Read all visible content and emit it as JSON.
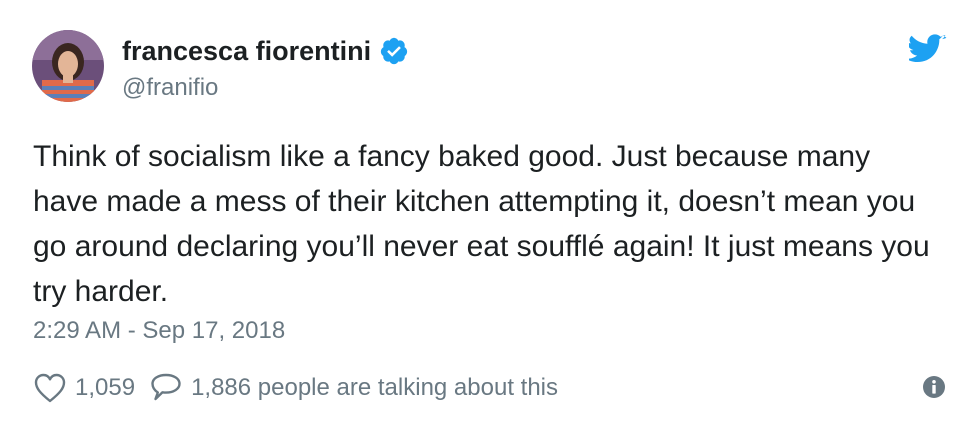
{
  "author": {
    "display_name": "francesca fiorentini",
    "handle": "@franifio"
  },
  "icons": {
    "verified": "verified-badge-icon",
    "brand": "twitter-bird-icon",
    "like": "heart-icon",
    "reply": "speech-bubble-icon",
    "info": "info-icon"
  },
  "colors": {
    "brand": "#1da1f2",
    "text": "#1c2022",
    "secondary_text": "#697882"
  },
  "tweet": {
    "text": "Think of socialism like a fancy baked good. Just because many have made a mess of their kitchen attempting it, doesn’t mean you go around declaring you’ll never eat soufflé again! It just means you try harder.",
    "timestamp": "2:29 AM - Sep 17, 2018"
  },
  "actions": {
    "likes": "1,059",
    "talking": "1,886 people are talking about this"
  }
}
